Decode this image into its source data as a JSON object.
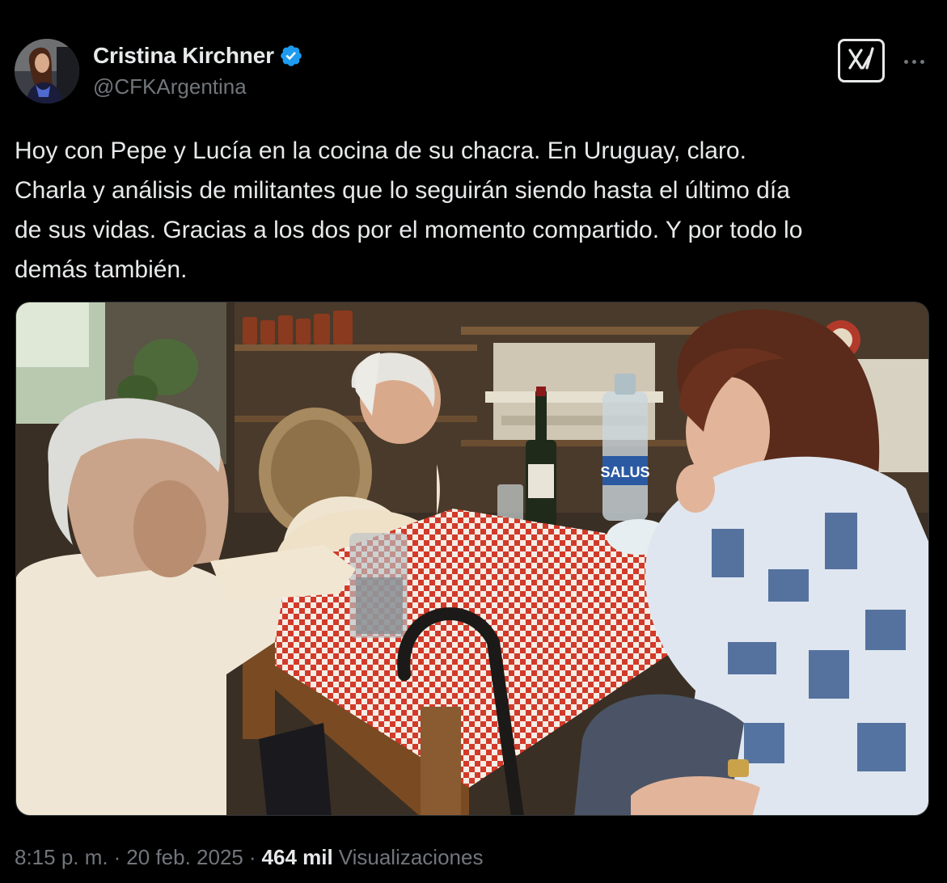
{
  "author": {
    "name": "Cristina Kirchner",
    "handle": "@CFKArgentina",
    "verified": true
  },
  "tweet": {
    "text": "Hoy con Pepe y Lucía en la cocina de su chacra. En Uruguay, claro.\nCharla y análisis de militantes que lo seguirán siendo hasta el último día\nde sus vidas. Gracias a los dos por el momento compartido. Y por todo lo\ndemás también."
  },
  "media": {
    "bottle_label": "SALUS"
  },
  "meta": {
    "time": "8:15 p. m.",
    "separator": "·",
    "date": "20 feb. 2025",
    "views_count": "464 mil",
    "views_label": "Visualizaciones"
  },
  "icons": {
    "verified": "verified-badge-icon",
    "grok": "grok-icon",
    "more": "more-dots-icon"
  },
  "colors": {
    "background": "#000000",
    "text_primary": "#e7e9ea",
    "text_secondary": "#71767b",
    "verified": "#1d9bf0"
  }
}
